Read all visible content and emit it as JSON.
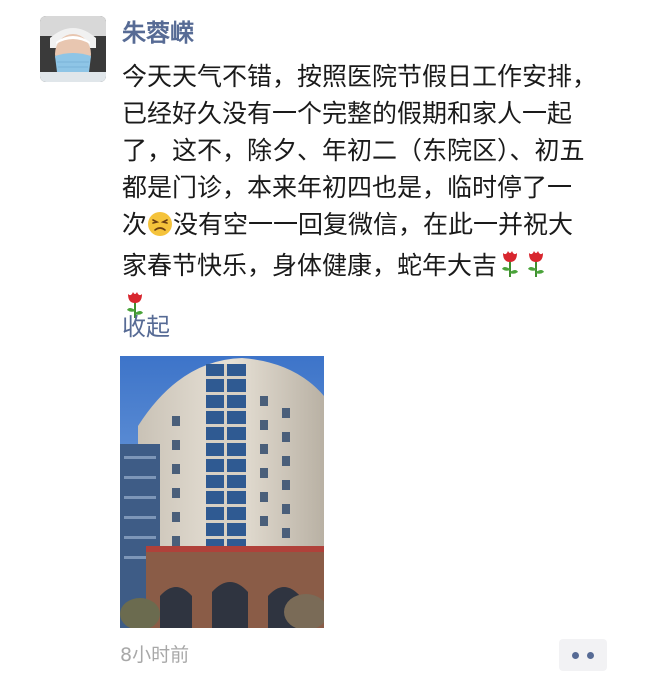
{
  "post": {
    "author": "朱蓉嵘",
    "text_lines": [
      "今天天气不错，按照医院节假日工作安排，",
      "已经好久没有一个完整的假期和家人一起",
      "了，这不，除夕、年初二（东院区）、初五",
      "都是门诊，本来年初四也是，临时停了一",
      "没有空一一回复微信，在此一并祝大",
      "家春节快乐，身体健康，蛇年大吉"
    ],
    "collapse_label": "收起",
    "timestamp": "8小时前"
  },
  "icons": {
    "line5_prefix_text": "次",
    "emoji": "tired-face-emoji",
    "flower": "rose-icon"
  },
  "colors": {
    "name_link": "#576b95",
    "text": "#1a1a1a",
    "muted": "#a8a8a8",
    "more_bg": "#f2f2f4"
  }
}
